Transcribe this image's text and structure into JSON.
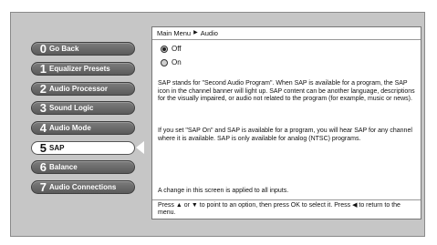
{
  "menu": {
    "items": [
      {
        "num": "0",
        "label": "Go Back"
      },
      {
        "num": "1",
        "label": "Equalizer Presets"
      },
      {
        "num": "2",
        "label": "Audio Processor"
      },
      {
        "num": "3",
        "label": "Sound Logic"
      },
      {
        "num": "4",
        "label": "Audio Mode"
      },
      {
        "num": "5",
        "label": "SAP"
      },
      {
        "num": "6",
        "label": "Balance"
      },
      {
        "num": "7",
        "label": "Audio Connections"
      }
    ],
    "selected_index": 5
  },
  "panel": {
    "breadcrumb": {
      "root": "Main Menu",
      "separator": "▶",
      "current": "Audio"
    },
    "options": [
      {
        "label": "Off",
        "selected": true
      },
      {
        "label": "On",
        "selected": false
      }
    ],
    "description_1": "SAP stands for \"Second Audio Program\". When SAP is available for a program, the SAP icon in the channel banner will light up. SAP content can be another language, descriptions for the visually impaired, or audio not related to the program (for example, music or news).",
    "description_2": "If you set \"SAP On\" and SAP is available for a program, you will hear SAP for any channel where it is available. SAP is only available for analog (NTSC) programs.",
    "note": "A change in this screen is applied to all inputs.",
    "help": "Press ▲ or ▼ to point to an option, then press OK to select it. Press ◀ to return to the menu."
  }
}
